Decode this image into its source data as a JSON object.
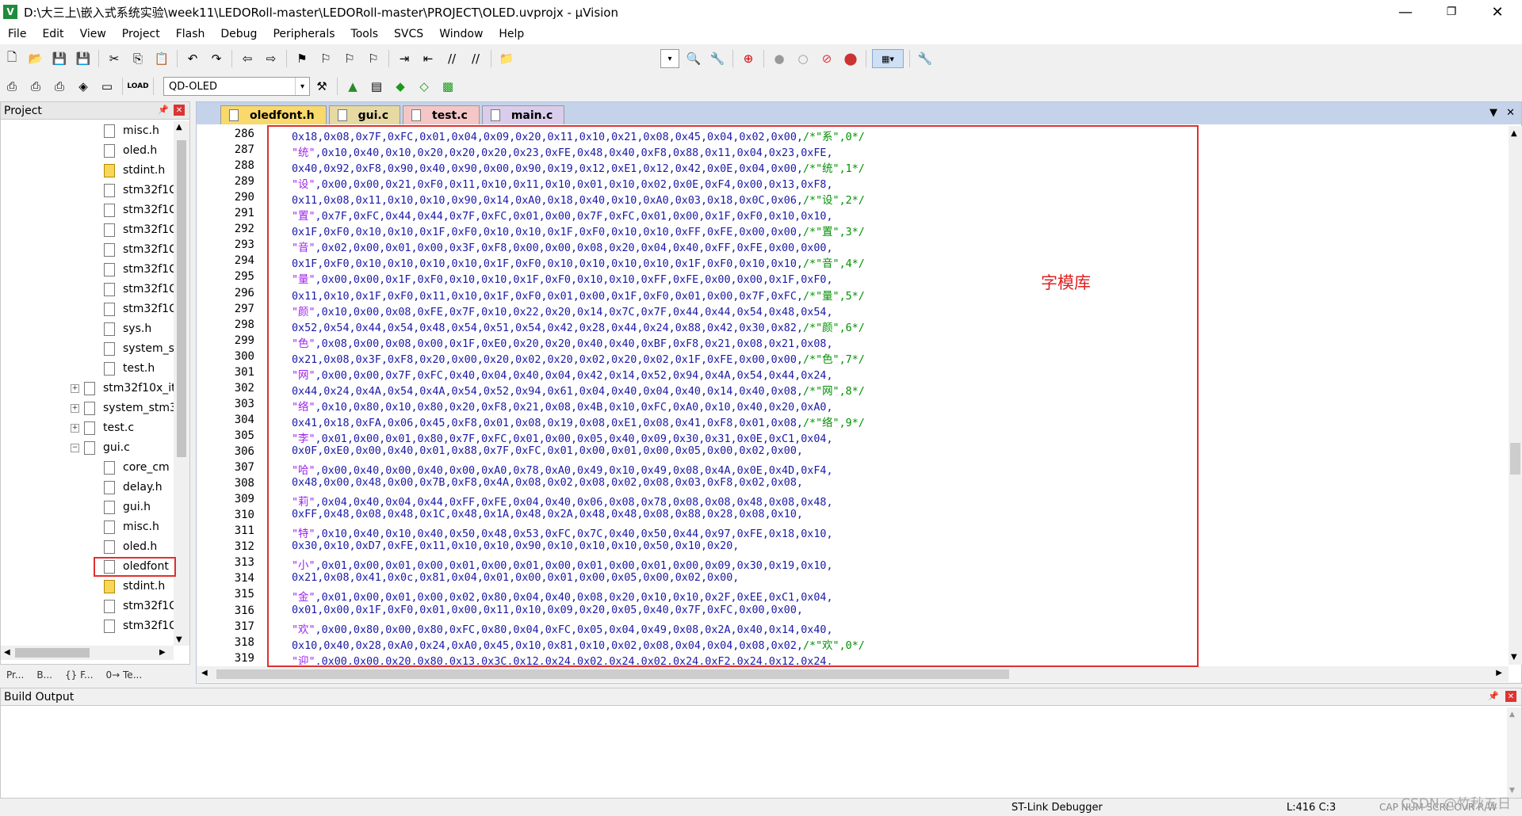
{
  "window": {
    "title": "D:\\大三上\\嵌入式系统实验\\week11\\LEDORoll-master\\LEDORoll-master\\PROJECT\\OLED.uvprojx - µVision",
    "app_icon": "V"
  },
  "menu": [
    "File",
    "Edit",
    "View",
    "Project",
    "Flash",
    "Debug",
    "Peripherals",
    "Tools",
    "SVCS",
    "Window",
    "Help"
  ],
  "target": {
    "name": "QD-OLED"
  },
  "project_panel": {
    "title": "Project",
    "items": [
      {
        "label": "misc.h",
        "level": 2,
        "icon": "file"
      },
      {
        "label": "oled.h",
        "level": 2,
        "icon": "file"
      },
      {
        "label": "stdint.h",
        "level": 2,
        "icon": "warn"
      },
      {
        "label": "stm32f1C",
        "level": 2,
        "icon": "file"
      },
      {
        "label": "stm32f1C",
        "level": 2,
        "icon": "file"
      },
      {
        "label": "stm32f1C",
        "level": 2,
        "icon": "file"
      },
      {
        "label": "stm32f1C",
        "level": 2,
        "icon": "file"
      },
      {
        "label": "stm32f1C",
        "level": 2,
        "icon": "file"
      },
      {
        "label": "stm32f1C",
        "level": 2,
        "icon": "file"
      },
      {
        "label": "stm32f1C",
        "level": 2,
        "icon": "file"
      },
      {
        "label": "sys.h",
        "level": 2,
        "icon": "file"
      },
      {
        "label": "system_s",
        "level": 2,
        "icon": "file"
      },
      {
        "label": "test.h",
        "level": 2,
        "icon": "file"
      },
      {
        "label": "stm32f10x_it",
        "level": 1,
        "icon": "file",
        "expander": "+"
      },
      {
        "label": "system_stm3",
        "level": 1,
        "icon": "file",
        "expander": "+"
      },
      {
        "label": "test.c",
        "level": 1,
        "icon": "file",
        "expander": "+"
      },
      {
        "label": "gui.c",
        "level": 1,
        "icon": "file",
        "expander": "−"
      },
      {
        "label": "core_cm",
        "level": 2,
        "icon": "file"
      },
      {
        "label": "delay.h",
        "level": 2,
        "icon": "file"
      },
      {
        "label": "gui.h",
        "level": 2,
        "icon": "file"
      },
      {
        "label": "misc.h",
        "level": 2,
        "icon": "file"
      },
      {
        "label": "oled.h",
        "level": 2,
        "icon": "file"
      },
      {
        "label": "oledfont",
        "level": 2,
        "icon": "file"
      },
      {
        "label": "stdint.h",
        "level": 2,
        "icon": "warn"
      },
      {
        "label": "stm32f1C",
        "level": 2,
        "icon": "file"
      },
      {
        "label": "stm32f1C",
        "level": 2,
        "icon": "file"
      }
    ],
    "bottom_tabs": [
      "Pr...",
      "B...",
      "{} F...",
      "0→ Te..."
    ]
  },
  "editor": {
    "tabs": [
      {
        "label": "oledfont.h",
        "active": true
      },
      {
        "label": "gui.c"
      },
      {
        "label": "test.c"
      },
      {
        "label": "main.c"
      }
    ],
    "lines": [
      {
        "n": "286",
        "parts": [
          [
            "hex",
            "0x18,0x08,0x7F,0xFC,0x01,0x04,0x09,0x20,0x11,0x10,0x21,0x08,0x45,0x04,0x02,0x00,"
          ],
          [
            "cmt",
            "/*\"系\",0*/"
          ]
        ]
      },
      {
        "n": "287",
        "parts": [
          [
            "str",
            "\"统\""
          ],
          [
            "hex",
            ",0x10,0x40,0x10,0x20,0x20,0x20,0x23,0xFE,0x48,0x40,0xF8,0x88,0x11,0x04,0x23,0xFE,"
          ]
        ]
      },
      {
        "n": "288",
        "parts": [
          [
            "hex",
            "0x40,0x92,0xF8,0x90,0x40,0x90,0x00,0x90,0x19,0x12,0xE1,0x12,0x42,0x0E,0x04,0x00,"
          ],
          [
            "cmt",
            "/*\"统\",1*/"
          ]
        ]
      },
      {
        "n": "289",
        "parts": [
          [
            "str",
            "\"设\""
          ],
          [
            "hex",
            ",0x00,0x00,0x21,0xF0,0x11,0x10,0x11,0x10,0x01,0x10,0x02,0x0E,0xF4,0x00,0x13,0xF8,"
          ]
        ]
      },
      {
        "n": "290",
        "parts": [
          [
            "hex",
            "0x11,0x08,0x11,0x10,0x10,0x90,0x14,0xA0,0x18,0x40,0x10,0xA0,0x03,0x18,0x0C,0x06,"
          ],
          [
            "cmt",
            "/*\"设\",2*/"
          ]
        ]
      },
      {
        "n": "291",
        "parts": [
          [
            "str",
            "\"置\""
          ],
          [
            "hex",
            ",0x7F,0xFC,0x44,0x44,0x7F,0xFC,0x01,0x00,0x7F,0xFC,0x01,0x00,0x1F,0xF0,0x10,0x10,"
          ]
        ]
      },
      {
        "n": "292",
        "parts": [
          [
            "hex",
            "0x1F,0xF0,0x10,0x10,0x1F,0xF0,0x10,0x10,0x1F,0xF0,0x10,0x10,0xFF,0xFE,0x00,0x00,"
          ],
          [
            "cmt",
            "/*\"置\",3*/"
          ]
        ]
      },
      {
        "n": "293",
        "parts": [
          [
            "str",
            "\"音\""
          ],
          [
            "hex",
            ",0x02,0x00,0x01,0x00,0x3F,0xF8,0x00,0x00,0x08,0x20,0x04,0x40,0xFF,0xFE,0x00,0x00,"
          ]
        ]
      },
      {
        "n": "294",
        "parts": [
          [
            "hex",
            "0x1F,0xF0,0x10,0x10,0x10,0x10,0x1F,0xF0,0x10,0x10,0x10,0x10,0x1F,0xF0,0x10,0x10,"
          ],
          [
            "cmt",
            "/*\"音\",4*/"
          ]
        ]
      },
      {
        "n": "295",
        "parts": [
          [
            "str",
            "\"量\""
          ],
          [
            "hex",
            ",0x00,0x00,0x1F,0xF0,0x10,0x10,0x1F,0xF0,0x10,0x10,0xFF,0xFE,0x00,0x00,0x1F,0xF0,"
          ]
        ]
      },
      {
        "n": "296",
        "parts": [
          [
            "hex",
            "0x11,0x10,0x1F,0xF0,0x11,0x10,0x1F,0xF0,0x01,0x00,0x1F,0xF0,0x01,0x00,0x7F,0xFC,"
          ],
          [
            "cmt",
            "/*\"量\",5*/"
          ]
        ]
      },
      {
        "n": "297",
        "parts": [
          [
            "str",
            "\"颜\""
          ],
          [
            "hex",
            ",0x10,0x00,0x08,0xFE,0x7F,0x10,0x22,0x20,0x14,0x7C,0x7F,0x44,0x44,0x54,0x48,0x54,"
          ]
        ]
      },
      {
        "n": "298",
        "parts": [
          [
            "hex",
            "0x52,0x54,0x44,0x54,0x48,0x54,0x51,0x54,0x42,0x28,0x44,0x24,0x88,0x42,0x30,0x82,"
          ],
          [
            "cmt",
            "/*\"颜\",6*/"
          ]
        ]
      },
      {
        "n": "299",
        "parts": [
          [
            "str",
            "\"色\""
          ],
          [
            "hex",
            ",0x08,0x00,0x08,0x00,0x1F,0xE0,0x20,0x20,0x40,0x40,0xBF,0xF8,0x21,0x08,0x21,0x08,"
          ]
        ]
      },
      {
        "n": "300",
        "parts": [
          [
            "hex",
            "0x21,0x08,0x3F,0xF8,0x20,0x00,0x20,0x02,0x20,0x02,0x20,0x02,0x1F,0xFE,0x00,0x00,"
          ],
          [
            "cmt",
            "/*\"色\",7*/"
          ]
        ]
      },
      {
        "n": "301",
        "parts": [
          [
            "str",
            "\"网\""
          ],
          [
            "hex",
            ",0x00,0x00,0x7F,0xFC,0x40,0x04,0x40,0x04,0x42,0x14,0x52,0x94,0x4A,0x54,0x44,0x24,"
          ]
        ]
      },
      {
        "n": "302",
        "parts": [
          [
            "hex",
            "0x44,0x24,0x4A,0x54,0x4A,0x54,0x52,0x94,0x61,0x04,0x40,0x04,0x40,0x14,0x40,0x08,"
          ],
          [
            "cmt",
            "/*\"网\",8*/"
          ]
        ]
      },
      {
        "n": "303",
        "parts": [
          [
            "str",
            "\"络\""
          ],
          [
            "hex",
            ",0x10,0x80,0x10,0x80,0x20,0xF8,0x21,0x08,0x4B,0x10,0xFC,0xA0,0x10,0x40,0x20,0xA0,"
          ]
        ]
      },
      {
        "n": "304",
        "parts": [
          [
            "hex",
            "0x41,0x18,0xFA,0x06,0x45,0xF8,0x01,0x08,0x19,0x08,0xE1,0x08,0x41,0xF8,0x01,0x08,"
          ],
          [
            "cmt",
            "/*\"络\",9*/"
          ]
        ]
      },
      {
        "n": "305",
        "parts": [
          [
            "str",
            "\"李\""
          ],
          [
            "hex",
            ",0x01,0x00,0x01,0x80,0x7F,0xFC,0x01,0x00,0x05,0x40,0x09,0x30,0x31,0x0E,0xC1,0x04,"
          ]
        ]
      },
      {
        "n": "306",
        "parts": [
          [
            "hex",
            "0x0F,0xE0,0x00,0x40,0x01,0x88,0x7F,0xFC,0x01,0x00,0x01,0x00,0x05,0x00,0x02,0x00,"
          ]
        ]
      },
      {
        "n": "307",
        "parts": [
          [
            "str",
            "\"哈\""
          ],
          [
            "hex",
            ",0x00,0x40,0x00,0x40,0x00,0xA0,0x78,0xA0,0x49,0x10,0x49,0x08,0x4A,0x0E,0x4D,0xF4,"
          ]
        ]
      },
      {
        "n": "308",
        "parts": [
          [
            "hex",
            "0x48,0x00,0x48,0x00,0x7B,0xF8,0x4A,0x08,0x02,0x08,0x02,0x08,0x03,0xF8,0x02,0x08,"
          ]
        ]
      },
      {
        "n": "309",
        "parts": [
          [
            "str",
            "\"莉\""
          ],
          [
            "hex",
            ",0x04,0x40,0x04,0x44,0xFF,0xFE,0x04,0x40,0x06,0x08,0x78,0x08,0x08,0x48,0x08,0x48,"
          ]
        ]
      },
      {
        "n": "310",
        "parts": [
          [
            "hex",
            "0xFF,0x48,0x08,0x48,0x1C,0x48,0x1A,0x48,0x2A,0x48,0x48,0x08,0x88,0x28,0x08,0x10,"
          ]
        ]
      },
      {
        "n": "311",
        "parts": [
          [
            "str",
            "\"特\""
          ],
          [
            "hex",
            ",0x10,0x40,0x10,0x40,0x50,0x48,0x53,0xFC,0x7C,0x40,0x50,0x44,0x97,0xFE,0x18,0x10,"
          ]
        ]
      },
      {
        "n": "312",
        "parts": [
          [
            "hex",
            "0x30,0x10,0xD7,0xFE,0x11,0x10,0x10,0x90,0x10,0x10,0x10,0x50,0x10,0x20,"
          ]
        ]
      },
      {
        "n": "313",
        "parts": [
          [
            "str",
            "\"小\""
          ],
          [
            "hex",
            ",0x01,0x00,0x01,0x00,0x01,0x00,0x01,0x00,0x01,0x00,0x01,0x00,0x09,0x30,0x19,0x10,"
          ]
        ]
      },
      {
        "n": "314",
        "parts": [
          [
            "hex",
            "0x21,0x08,0x41,0x0c,0x81,0x04,0x01,0x00,0x01,0x00,0x05,0x00,0x02,0x00,"
          ]
        ]
      },
      {
        "n": "315",
        "parts": [
          [
            "str",
            "\"金\""
          ],
          [
            "hex",
            ",0x01,0x00,0x01,0x00,0x02,0x80,0x04,0x40,0x08,0x20,0x10,0x10,0x2F,0xEE,0xC1,0x04,"
          ]
        ]
      },
      {
        "n": "316",
        "parts": [
          [
            "hex",
            "0x01,0x00,0x1F,0xF0,0x01,0x00,0x11,0x10,0x09,0x20,0x05,0x40,0x7F,0xFC,0x00,0x00,"
          ]
        ]
      },
      {
        "n": "317",
        "parts": [
          [
            "str",
            "\"欢\""
          ],
          [
            "hex",
            ",0x00,0x80,0x00,0x80,0xFC,0x80,0x04,0xFC,0x05,0x04,0x49,0x08,0x2A,0x40,0x14,0x40,"
          ]
        ]
      },
      {
        "n": "318",
        "parts": [
          [
            "hex",
            "0x10,0x40,0x28,0xA0,0x24,0xA0,0x45,0x10,0x81,0x10,0x02,0x08,0x04,0x04,0x08,0x02,"
          ],
          [
            "cmt",
            "/*\"欢\",0*/"
          ]
        ]
      },
      {
        "n": "319",
        "parts": [
          [
            "str",
            "\"迎\""
          ],
          [
            "hex",
            ",0x00,0x00,0x20,0x80,0x13,0x3C,0x12,0x24,0x02,0x24,0x02,0x24,0xF2,0x24,0x12,0x24,"
          ]
        ]
      }
    ]
  },
  "annotation": {
    "text": "字模库"
  },
  "build_output": {
    "title": "Build Output"
  },
  "statusbar": {
    "debugger": "ST-Link Debugger",
    "position": "L:416 C:3",
    "flags": "CAP  NUM  SCRL  OVR  R/W"
  },
  "watermark": "CSDN @竹秋五日",
  "colors": {
    "annotation_red": "#e03030",
    "tab_active": "#f9d86c",
    "tab_strip": "#c5d3ea",
    "hex_text": "#1a1aa6",
    "string_text": "#a020f0",
    "comment_text": "#009000"
  }
}
